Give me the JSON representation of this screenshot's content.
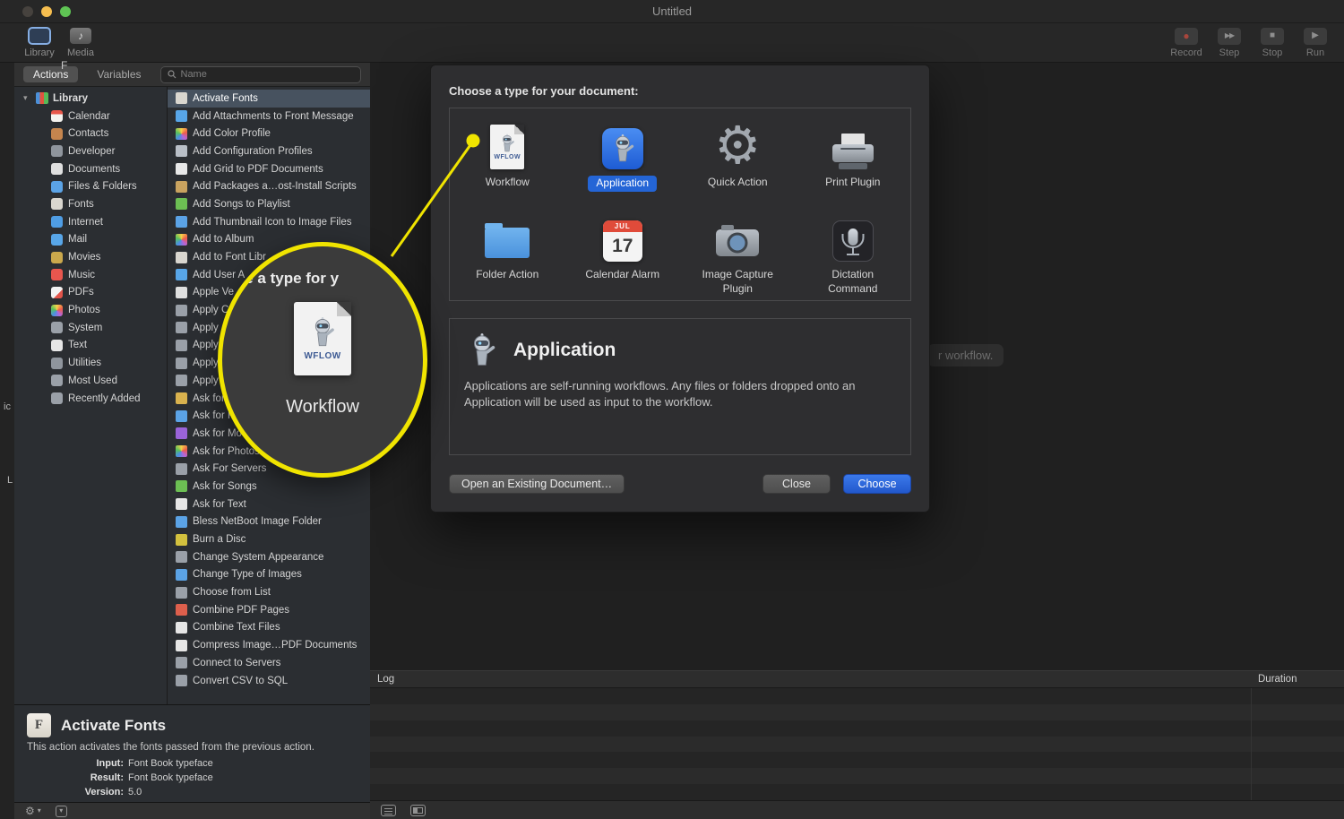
{
  "window": {
    "title": "Untitled",
    "toolbar": {
      "library_label": "Library",
      "media_label": "Media",
      "record_label": "Record",
      "step_label": "Step",
      "stop_label": "Stop",
      "run_label": "Run"
    }
  },
  "icons": {
    "gear": "⚙",
    "record": "●",
    "step": "▶▶",
    "stop": "■",
    "run": "▶",
    "disclosure_down": "▾",
    "music_note": "♪",
    "chevron_down": "▾"
  },
  "panel": {
    "tabs": {
      "actions": "Actions",
      "variables": "Variables"
    },
    "search_placeholder": "Name",
    "sidebar": {
      "root_label": "Library",
      "items": [
        {
          "label": "Calendar",
          "color": "linear-gradient(#e8574a 35%, #f5f3ef 35%)"
        },
        {
          "label": "Contacts",
          "color": "#c5854e"
        },
        {
          "label": "Developer",
          "color": "#8f959d"
        },
        {
          "label": "Documents",
          "color": "#dfdfdf"
        },
        {
          "label": "Files & Folders",
          "color": "#5ba3e6"
        },
        {
          "label": "Fonts",
          "color": "#d9d6cf"
        },
        {
          "label": "Internet",
          "color": "#4f9de4"
        },
        {
          "label": "Mail",
          "color": "#58a6e8"
        },
        {
          "label": "Movies",
          "color": "#caa84c"
        },
        {
          "label": "Music",
          "color": "#e8564e"
        },
        {
          "label": "PDFs",
          "color": "linear-gradient(135deg,#f2f2f2 60%, #e2544a 60%)"
        },
        {
          "label": "Photos",
          "color": "conic-gradient(#f7d24a,#ef5b49,#b565d8,#4a90e2,#58c15a,#f7d24a)"
        },
        {
          "label": "System",
          "color": "#9aa0a8"
        },
        {
          "label": "Text",
          "color": "#e6e6e6"
        },
        {
          "label": "Utilities",
          "color": "#8f959d"
        },
        {
          "label": "Most Used",
          "color": "#9aa0a8"
        },
        {
          "label": "Recently Added",
          "color": "#9aa0a8"
        }
      ]
    },
    "actions": {
      "items": [
        {
          "label": "Activate Fonts",
          "color": "#d9d6cf",
          "state": "selected"
        },
        {
          "label": "Add Attachments to Front Message",
          "color": "#58a6e8"
        },
        {
          "label": "Add Color Profile",
          "color": "conic-gradient(#f7d24a,#ef5b49,#b565d8,#4a90e2,#58c15a,#f7d24a)"
        },
        {
          "label": "Add Configuration Profiles",
          "color": "#b9bfc7"
        },
        {
          "label": "Add Grid to PDF Documents",
          "color": "#e8e8e8"
        },
        {
          "label": "Add Packages a…ost-Install Scripts",
          "color": "#c9a35f"
        },
        {
          "label": "Add Songs to Playlist",
          "color": "#6cbf53"
        },
        {
          "label": "Add Thumbnail Icon to Image Files",
          "color": "#5ba3e6"
        },
        {
          "label": "Add to Album",
          "color": "conic-gradient(#f7d24a,#ef5b49,#b565d8,#4a90e2,#58c15a,#f7d24a)"
        },
        {
          "label": "Add to Font Libr",
          "color": "#d9d6cf"
        },
        {
          "label": "Add User A",
          "color": "#58a6e8"
        },
        {
          "label": "Apple Ve",
          "color": "#dfdfdf"
        },
        {
          "label": "Apply C",
          "color": "#9aa0a8"
        },
        {
          "label": "Apply",
          "color": "#9aa0a8"
        },
        {
          "label": "Apply",
          "color": "#9aa0a8"
        },
        {
          "label": "Apply S",
          "color": "#9aa0a8"
        },
        {
          "label": "Apply S",
          "color": "#9aa0a8"
        },
        {
          "label": "Ask for C",
          "color": "#d9b24e"
        },
        {
          "label": "Ask for Fin",
          "color": "#5ba3e6"
        },
        {
          "label": "Ask for Movies",
          "color": "#9a63d8"
        },
        {
          "label": "Ask for Photos",
          "color": "conic-gradient(#f7d24a,#ef5b49,#b565d8,#4a90e2,#58c15a,#f7d24a)"
        },
        {
          "label": "Ask For Servers",
          "color": "#9aa0a8"
        },
        {
          "label": "Ask for Songs",
          "color": "#6cbf53"
        },
        {
          "label": "Ask for Text",
          "color": "#e6e6e6"
        },
        {
          "label": "Bless NetBoot Image Folder",
          "color": "#5ba3e6"
        },
        {
          "label": "Burn a Disc",
          "color": "#d3c13e"
        },
        {
          "label": "Change System Appearance",
          "color": "#9aa0a8"
        },
        {
          "label": "Change Type of Images",
          "color": "#5ba3e6"
        },
        {
          "label": "Choose from List",
          "color": "#9aa0a8"
        },
        {
          "label": "Combine PDF Pages",
          "color": "#dd5f4c"
        },
        {
          "label": "Combine Text Files",
          "color": "#e6e6e6"
        },
        {
          "label": "Compress Image…PDF Documents",
          "color": "#e6e6e6"
        },
        {
          "label": "Connect to Servers",
          "color": "#9aa0a8"
        },
        {
          "label": "Convert CSV to SQL",
          "color": "#9aa0a8"
        }
      ]
    },
    "action_detail": {
      "title": "Activate Fonts",
      "description": "This action activates the fonts passed from the previous action.",
      "fields": [
        {
          "label": "Input:",
          "value": "Font Book typeface"
        },
        {
          "label": "Result:",
          "value": "Font Book typeface"
        },
        {
          "label": "Version:",
          "value": "5.0"
        }
      ]
    }
  },
  "dialog": {
    "heading": "Choose a type for your document:",
    "types": [
      {
        "label": "Workflow"
      },
      {
        "label": "Application",
        "selected": true
      },
      {
        "label": "Quick Action"
      },
      {
        "label": "Print Plugin"
      },
      {
        "label": "Folder Action"
      },
      {
        "label": "Calendar Alarm"
      },
      {
        "label": "Image Capture Plugin"
      },
      {
        "label": "Dictation Command"
      }
    ],
    "workflow_badge": "WFLOW",
    "calendar_month": "JUL",
    "calendar_day": "17",
    "detail": {
      "title": "Application",
      "description": "Applications are self-running workflows. Any files or folders dropped onto an Application will be used as input to the workflow."
    },
    "buttons": {
      "open_existing": "Open an Existing Document…",
      "close": "Close",
      "choose": "Choose"
    },
    "selection_color": "#2465d6"
  },
  "callout": {
    "partial_heading": "oose a type for y",
    "badge": "WFLOW",
    "label": "Workflow",
    "accent_color": "#f0e400"
  },
  "log": {
    "log_column": "Log",
    "duration_column": "Duration"
  },
  "background_fragments": {
    "pill": "r workflow.",
    "letter_f": "F",
    "letters_ic": "ic",
    "letter_l": "L"
  }
}
